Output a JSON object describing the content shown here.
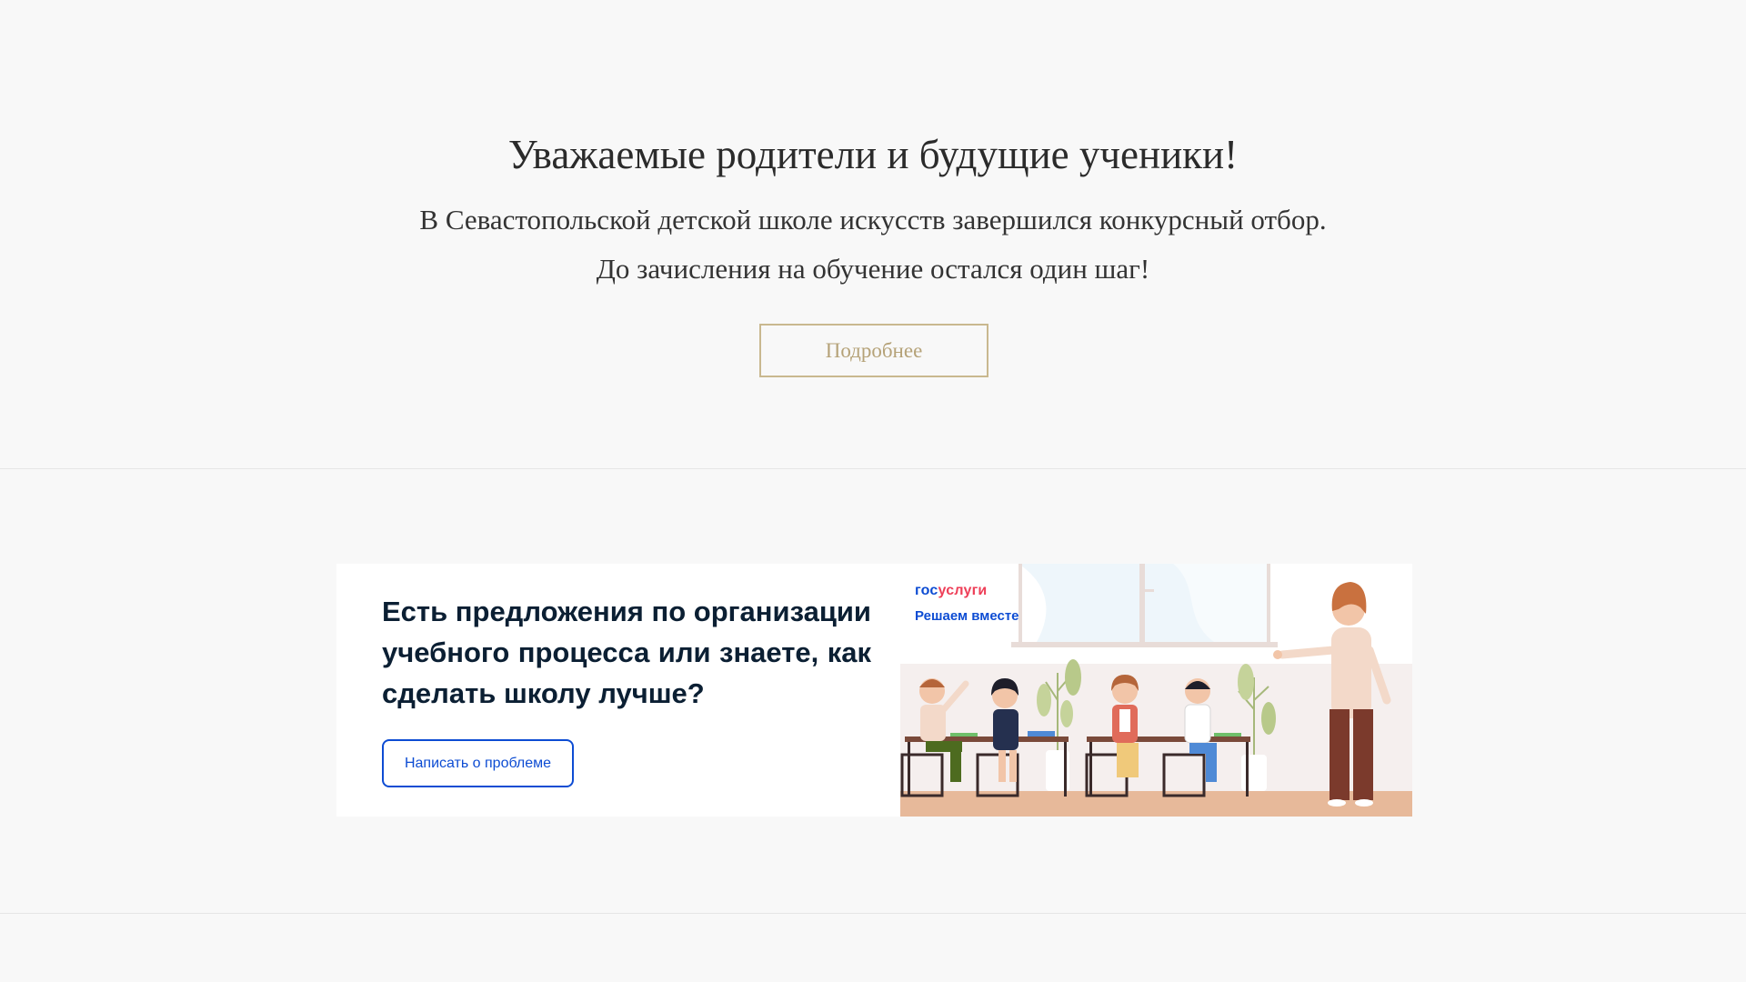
{
  "announcement": {
    "title": "Уважаемые родители и будущие ученики!",
    "line1": "В Севастопольской детской школе искусств завершился конкурсный отбор.",
    "line2": "До зачисления на обучение остался один шаг!",
    "more_label": "Подробнее",
    "accent_color": "#c9b88f"
  },
  "gosuslugi_banner": {
    "heading": "Есть предложения по организации учебного процесса или знаете, как сделать школу лучше?",
    "button_label": "Написать о проблеме",
    "logo_gos": "гос",
    "logo_uslugi": "услуги",
    "tagline": "Решаем вместе",
    "brand_blue": "#0d4cd3",
    "brand_red": "#ee3f58",
    "illustration_icon": "classroom-illustration"
  }
}
